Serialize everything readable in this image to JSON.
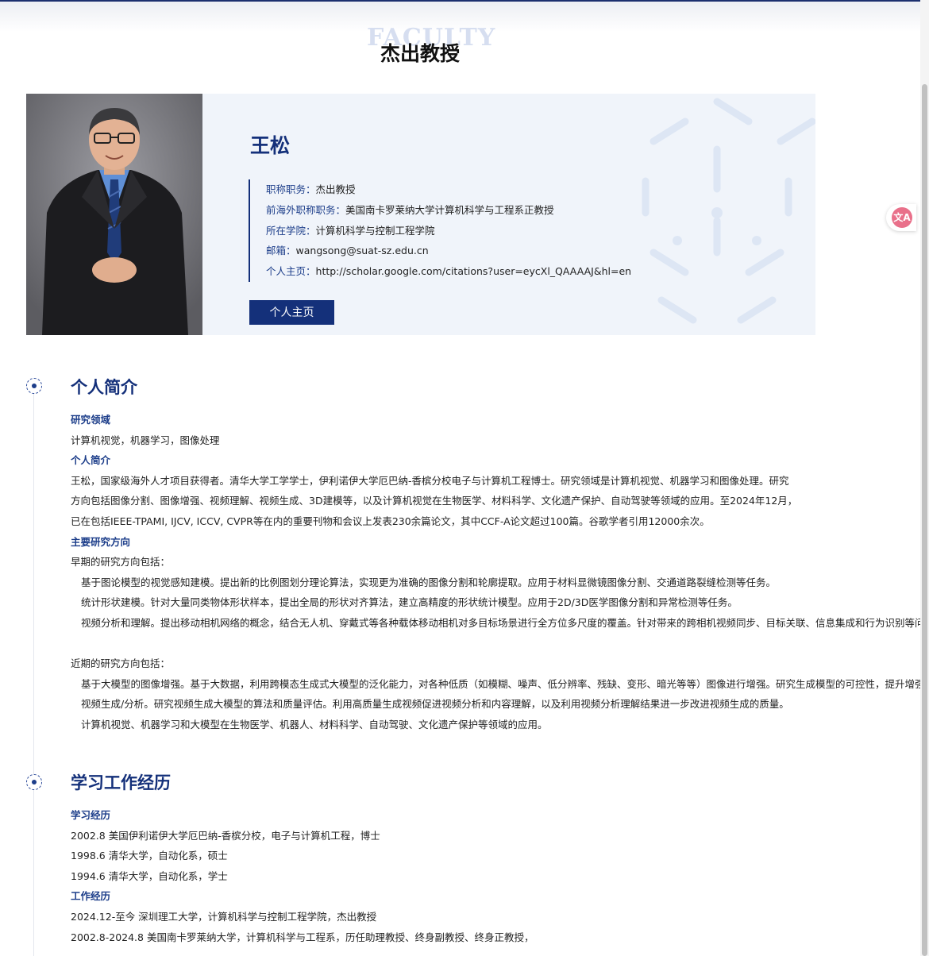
{
  "header": {
    "bg_word": "FACULTY",
    "title": "杰出教授"
  },
  "profile": {
    "name": "王松",
    "fields": [
      {
        "label": "职称职务：",
        "value": "杰出教授"
      },
      {
        "label": "前海外职称职务：",
        "value": "美国南卡罗莱纳大学计算机科学与工程系正教授"
      },
      {
        "label": "所在学院：",
        "value": "计算机科学与控制工程学院"
      },
      {
        "label": "邮箱：",
        "value": "wangsong@suat-sz.edu.cn"
      },
      {
        "label": "个人主页：",
        "value": "http://scholar.google.com/citations?user=eycXl_QAAAAJ&hl=en"
      }
    ],
    "homepage_button": "个人主页"
  },
  "translate_icon": "translate-icon",
  "sections": {
    "intro": {
      "title": "个人简介",
      "research_heading": "研究领域",
      "research": "计算机视觉，机器学习，图像处理",
      "bio_heading": "个人简介",
      "bio_lines": [
        "王松，国家级海外人才项目获得者。清华大学工学学士，伊利诺伊大学厄巴纳-香槟分校电子与计算机工程博士。研究领域是计算机视觉、机器学习和图像处理。研究",
        "方向包括图像分割、图像增强、视频理解、视频生成、3D建模等，以及计算机视觉在生物医学、材料科学、文化遗产保护、自动驾驶等领域的应用。至2024年12月，",
        "已在包括IEEE-TPAMI, IJCV, ICCV, CVPR等在内的重要刊物和会议上发表230余篇论文，其中CCF-A论文超过100篇。谷歌学者引用12000余次。"
      ],
      "directions_heading": "主要研究方向",
      "early_intro": "早期的研究方向包括：",
      "early_items": [
        "基于图论模型的视觉感知建模。提出新的比例图划分理论算法，实现更为准确的图像分割和轮廓提取。应用于材料显微镜图像分割、交通道路裂缝检测等任务。",
        "统计形状建模。针对大量同类物体形状样本，提出全局的形状对齐算法，建立高精度的形状统计模型。应用于2D/3D医学图像分割和异常检测等任务。",
        "视频分析和理解。提出移动相机网络的概念，结合无人机、穿戴式等各种载体移动相机对多目标场景进行全方位多尺度的覆盖。针对带来的跨相机视频同步、目标关联、信息集成和行为识别等问题开展研究。"
      ],
      "recent_intro": "近期的研究方向包括：",
      "recent_items": [
        "基于大模型的图像增强。基于大数据，利用跨模态生成式大模型的泛化能力，对各种低质（如模糊、噪声、低分辨率、残缺、变形、暗光等等）图像进行增强。研究生成模型的可控性，提升增强结果的可靠性。",
        "视频生成/分析。研究视频生成大模型的算法和质量评估。利用高质量生成视频促进视频分析和内容理解，以及利用视频分析理解结果进一步改进视频生成的质量。",
        "计算机视觉、机器学习和大模型在生物医学、机器人、材料科学、自动驾驶、文化遗产保护等领域的应用。"
      ]
    },
    "career": {
      "title": "学习工作经历",
      "study_heading": "学习经历",
      "study_items": [
        "2002.8 美国伊利诺伊大学厄巴纳-香槟分校，电子与计算机工程，博士",
        "1998.6 清华大学，自动化系，硕士",
        "1994.6 清华大学，自动化系，学士"
      ],
      "work_heading": "工作经历",
      "work_items": [
        "2024.12-至今 深圳理工大学，计算机科学与控制工程学院，杰出教授",
        "2002.8-2024.8 美国南卡罗莱纳大学，计算机科学与工程系，历任助理教授、终身副教授、终身正教授，"
      ]
    }
  }
}
